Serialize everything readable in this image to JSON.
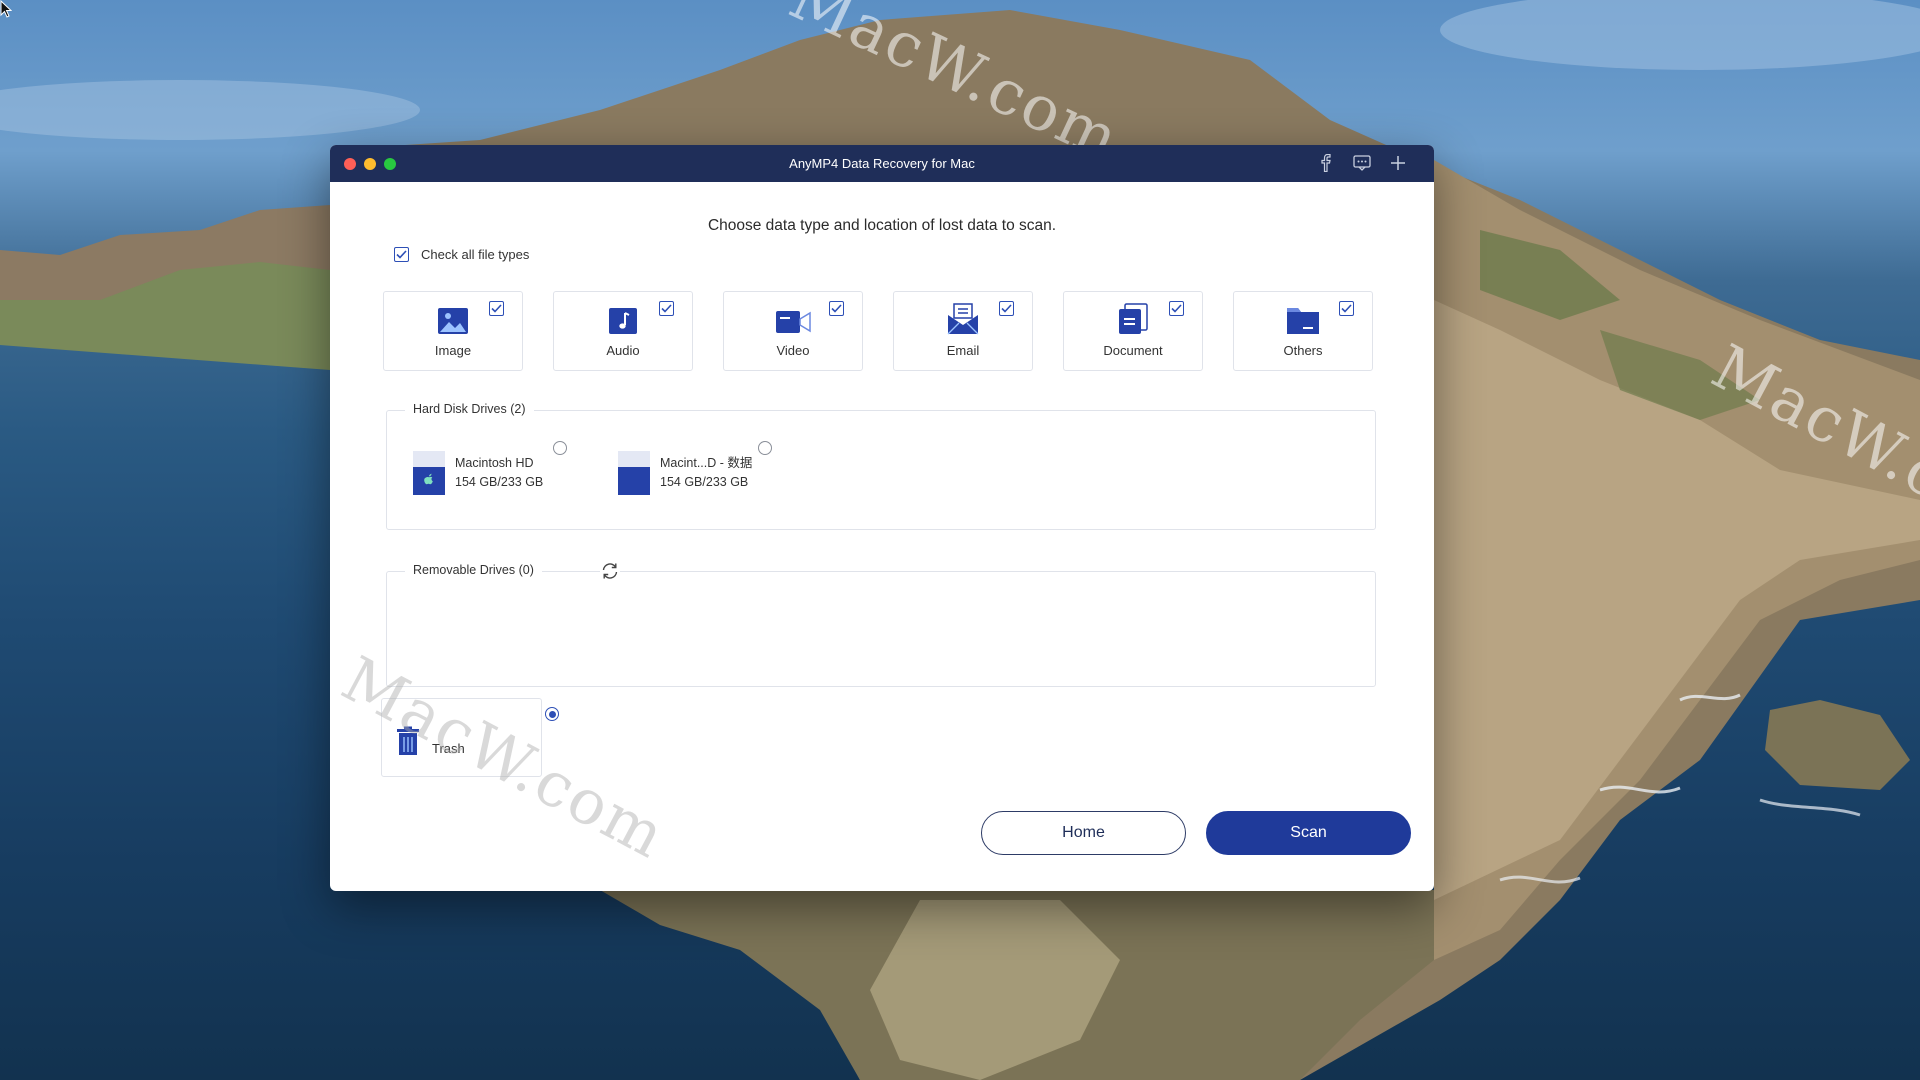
{
  "window": {
    "title": "AnyMP4 Data Recovery for Mac"
  },
  "watermark": {
    "text": "MacW.com"
  },
  "main": {
    "heading": "Choose data type and location of lost data to scan.",
    "check_all": {
      "label": "Check all file types",
      "checked": true
    },
    "file_types": [
      {
        "label": "Image",
        "icon": "image-icon",
        "checked": true
      },
      {
        "label": "Audio",
        "icon": "music-note-icon",
        "checked": true
      },
      {
        "label": "Video",
        "icon": "video-camera-icon",
        "checked": true
      },
      {
        "label": "Email",
        "icon": "envelope-icon",
        "checked": true
      },
      {
        "label": "Document",
        "icon": "document-icon",
        "checked": true
      },
      {
        "label": "Others",
        "icon": "folder-icon",
        "checked": true
      }
    ],
    "hard_disk_drives": {
      "title": "Hard Disk Drives (2)",
      "drives": [
        {
          "name": "Macintosh HD",
          "usage": "154 GB/233 GB",
          "icon": "apple-drive-icon",
          "selected": false
        },
        {
          "name": "Macint...D - 数据",
          "usage": "154 GB/233 GB",
          "icon": "drive-icon",
          "selected": false
        }
      ]
    },
    "removable_drives": {
      "title": "Removable Drives (0)",
      "refresh_icon": "refresh-icon"
    },
    "trash": {
      "label": "Trash",
      "icon": "trash-icon",
      "selected": true
    }
  },
  "footer": {
    "home_label": "Home",
    "scan_label": "Scan"
  },
  "colors": {
    "titlebar": "#1f2e59",
    "accent": "#1f3a9a",
    "icon_blue": "#2541a8"
  }
}
